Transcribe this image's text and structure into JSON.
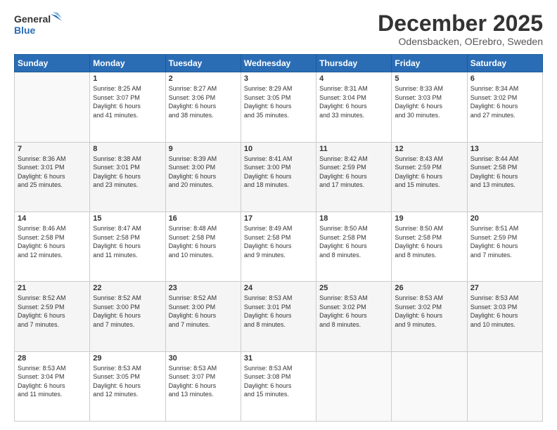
{
  "logo": {
    "line1": "General",
    "line2": "Blue"
  },
  "title": "December 2025",
  "location": "Odensbacken, OErebro, Sweden",
  "header_days": [
    "Sunday",
    "Monday",
    "Tuesday",
    "Wednesday",
    "Thursday",
    "Friday",
    "Saturday"
  ],
  "weeks": [
    [
      {
        "day": "",
        "info": ""
      },
      {
        "day": "1",
        "info": "Sunrise: 8:25 AM\nSunset: 3:07 PM\nDaylight: 6 hours\nand 41 minutes."
      },
      {
        "day": "2",
        "info": "Sunrise: 8:27 AM\nSunset: 3:06 PM\nDaylight: 6 hours\nand 38 minutes."
      },
      {
        "day": "3",
        "info": "Sunrise: 8:29 AM\nSunset: 3:05 PM\nDaylight: 6 hours\nand 35 minutes."
      },
      {
        "day": "4",
        "info": "Sunrise: 8:31 AM\nSunset: 3:04 PM\nDaylight: 6 hours\nand 33 minutes."
      },
      {
        "day": "5",
        "info": "Sunrise: 8:33 AM\nSunset: 3:03 PM\nDaylight: 6 hours\nand 30 minutes."
      },
      {
        "day": "6",
        "info": "Sunrise: 8:34 AM\nSunset: 3:02 PM\nDaylight: 6 hours\nand 27 minutes."
      }
    ],
    [
      {
        "day": "7",
        "info": "Sunrise: 8:36 AM\nSunset: 3:01 PM\nDaylight: 6 hours\nand 25 minutes."
      },
      {
        "day": "8",
        "info": "Sunrise: 8:38 AM\nSunset: 3:01 PM\nDaylight: 6 hours\nand 23 minutes."
      },
      {
        "day": "9",
        "info": "Sunrise: 8:39 AM\nSunset: 3:00 PM\nDaylight: 6 hours\nand 20 minutes."
      },
      {
        "day": "10",
        "info": "Sunrise: 8:41 AM\nSunset: 3:00 PM\nDaylight: 6 hours\nand 18 minutes."
      },
      {
        "day": "11",
        "info": "Sunrise: 8:42 AM\nSunset: 2:59 PM\nDaylight: 6 hours\nand 17 minutes."
      },
      {
        "day": "12",
        "info": "Sunrise: 8:43 AM\nSunset: 2:59 PM\nDaylight: 6 hours\nand 15 minutes."
      },
      {
        "day": "13",
        "info": "Sunrise: 8:44 AM\nSunset: 2:58 PM\nDaylight: 6 hours\nand 13 minutes."
      }
    ],
    [
      {
        "day": "14",
        "info": "Sunrise: 8:46 AM\nSunset: 2:58 PM\nDaylight: 6 hours\nand 12 minutes."
      },
      {
        "day": "15",
        "info": "Sunrise: 8:47 AM\nSunset: 2:58 PM\nDaylight: 6 hours\nand 11 minutes."
      },
      {
        "day": "16",
        "info": "Sunrise: 8:48 AM\nSunset: 2:58 PM\nDaylight: 6 hours\nand 10 minutes."
      },
      {
        "day": "17",
        "info": "Sunrise: 8:49 AM\nSunset: 2:58 PM\nDaylight: 6 hours\nand 9 minutes."
      },
      {
        "day": "18",
        "info": "Sunrise: 8:50 AM\nSunset: 2:58 PM\nDaylight: 6 hours\nand 8 minutes."
      },
      {
        "day": "19",
        "info": "Sunrise: 8:50 AM\nSunset: 2:58 PM\nDaylight: 6 hours\nand 8 minutes."
      },
      {
        "day": "20",
        "info": "Sunrise: 8:51 AM\nSunset: 2:59 PM\nDaylight: 6 hours\nand 7 minutes."
      }
    ],
    [
      {
        "day": "21",
        "info": "Sunrise: 8:52 AM\nSunset: 2:59 PM\nDaylight: 6 hours\nand 7 minutes."
      },
      {
        "day": "22",
        "info": "Sunrise: 8:52 AM\nSunset: 3:00 PM\nDaylight: 6 hours\nand 7 minutes."
      },
      {
        "day": "23",
        "info": "Sunrise: 8:52 AM\nSunset: 3:00 PM\nDaylight: 6 hours\nand 7 minutes."
      },
      {
        "day": "24",
        "info": "Sunrise: 8:53 AM\nSunset: 3:01 PM\nDaylight: 6 hours\nand 8 minutes."
      },
      {
        "day": "25",
        "info": "Sunrise: 8:53 AM\nSunset: 3:02 PM\nDaylight: 6 hours\nand 8 minutes."
      },
      {
        "day": "26",
        "info": "Sunrise: 8:53 AM\nSunset: 3:02 PM\nDaylight: 6 hours\nand 9 minutes."
      },
      {
        "day": "27",
        "info": "Sunrise: 8:53 AM\nSunset: 3:03 PM\nDaylight: 6 hours\nand 10 minutes."
      }
    ],
    [
      {
        "day": "28",
        "info": "Sunrise: 8:53 AM\nSunset: 3:04 PM\nDaylight: 6 hours\nand 11 minutes."
      },
      {
        "day": "29",
        "info": "Sunrise: 8:53 AM\nSunset: 3:05 PM\nDaylight: 6 hours\nand 12 minutes."
      },
      {
        "day": "30",
        "info": "Sunrise: 8:53 AM\nSunset: 3:07 PM\nDaylight: 6 hours\nand 13 minutes."
      },
      {
        "day": "31",
        "info": "Sunrise: 8:53 AM\nSunset: 3:08 PM\nDaylight: 6 hours\nand 15 minutes."
      },
      {
        "day": "",
        "info": ""
      },
      {
        "day": "",
        "info": ""
      },
      {
        "day": "",
        "info": ""
      }
    ]
  ]
}
